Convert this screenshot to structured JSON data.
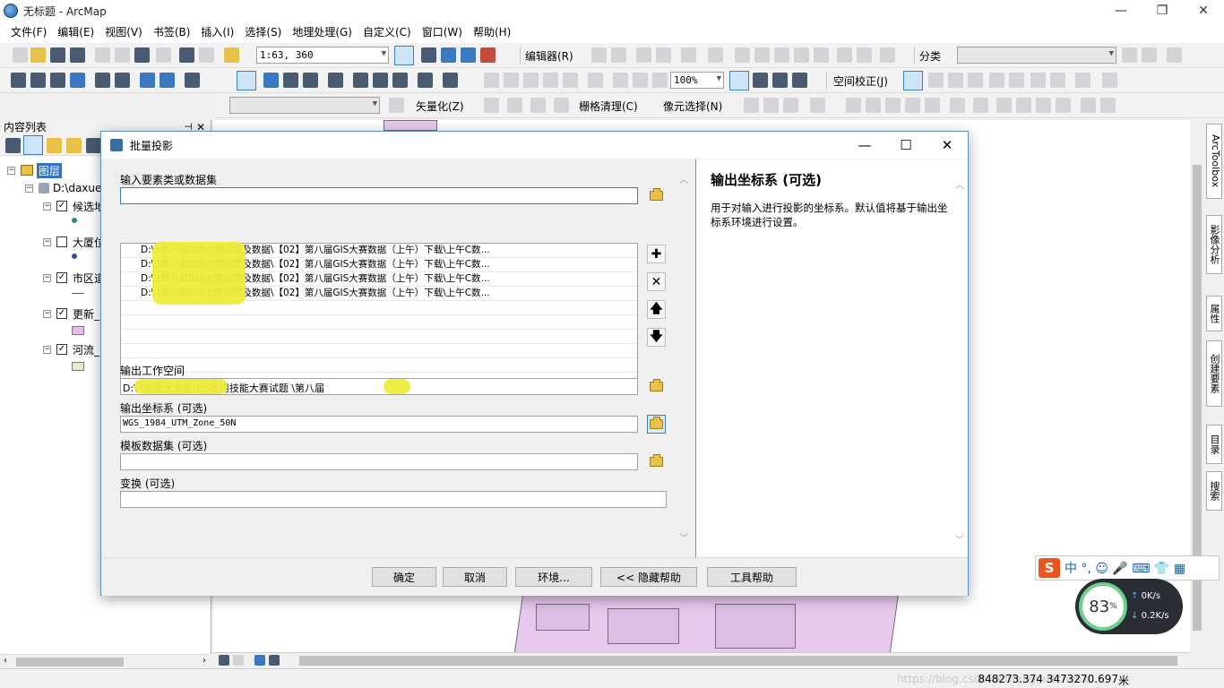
{
  "window": {
    "title": "无标题 - ArcMap"
  },
  "menu": [
    "文件(F)",
    "编辑(E)",
    "视图(V)",
    "书签(B)",
    "插入(I)",
    "选择(S)",
    "地理处理(G)",
    "自定义(C)",
    "窗口(W)",
    "帮助(H)"
  ],
  "toolbar": {
    "scale": "1:63, 360",
    "editor_label": "编辑器(R)",
    "classify_label": "分类",
    "zoom": "100%",
    "spatial_adjust": "空间校正(J)",
    "vectorize": "矢量化(Z)",
    "raster_cleanup": "栅格清理(C)",
    "pixel_select": "像元选择(N)"
  },
  "toc": {
    "header": "内容列表",
    "pin": "⊣",
    "close": "✕",
    "root": "图层",
    "folder": "D:\\daxue",
    "layers": [
      {
        "name": "候选地",
        "checked": true
      },
      {
        "name": "大厦位",
        "checked": false
      },
      {
        "name": "市区道",
        "checked": true
      },
      {
        "name": "更新_",
        "checked": true
      },
      {
        "name": "河流_",
        "checked": true
      }
    ]
  },
  "right_dock": [
    "ArcToolbox",
    "影像分析",
    "属性",
    "创建要素",
    "目录",
    "搜索"
  ],
  "dialog": {
    "title": "批量投影",
    "input_label": "输入要素类或数据集",
    "input_value": "",
    "list_items": [
      "D:\\                  \\第八届GIS大赛试题及数据\\【02】第八届GIS大赛数据（上午）下载\\上午C数...",
      "D:\\                  \\第八届GIS大赛试题及数据\\【02】第八届GIS大赛数据（上午）下载\\上午C数...",
      "D:\\                  \\第八届GIS大赛试题及数据\\【02】第八届GIS大赛数据（上午）下载\\上午C数...",
      "D:\\                  \\第八届GIS大赛试题及数据\\【02】第八届GIS大赛数据（上午）下载\\上午C数..."
    ],
    "list_buttons": {
      "add": "✚",
      "remove": "✕",
      "up": "🡅",
      "down": "🡇"
    },
    "workspace_label": "输出工作空间",
    "workspace_value": "D:\\                 \\全国大学生GIS应用技能大赛试题        \\第八届",
    "crs_label": "输出坐标系 (可选)",
    "crs_value": "WGS_1984_UTM_Zone_50N",
    "template_label": "模板数据集 (可选)",
    "template_value": "",
    "transform_label": "变换 (可选)",
    "transform_value": "",
    "buttons": {
      "ok": "确定",
      "cancel": "取消",
      "env": "环境...",
      "hide_help": "<< 隐藏帮助",
      "tool_help": "工具帮助"
    },
    "help": {
      "title": "输出坐标系 (可选)",
      "body": "用于对输入进行投影的坐标系。默认值将基于输出坐标系环境进行设置。"
    }
  },
  "status": {
    "coords": "848273.374  3473270.697",
    "unit": "米",
    "watermark": "https://blog.csdn.net/fengyuechenxi"
  },
  "ime": {
    "logo": "S",
    "glyphs": "中 °, ☺ 🎤 ⌨ 👕 ▦"
  },
  "net_monitor": {
    "cpu": "83",
    "cpu_unit": "%",
    "up": "0K/s",
    "down": "0.2K/s"
  }
}
